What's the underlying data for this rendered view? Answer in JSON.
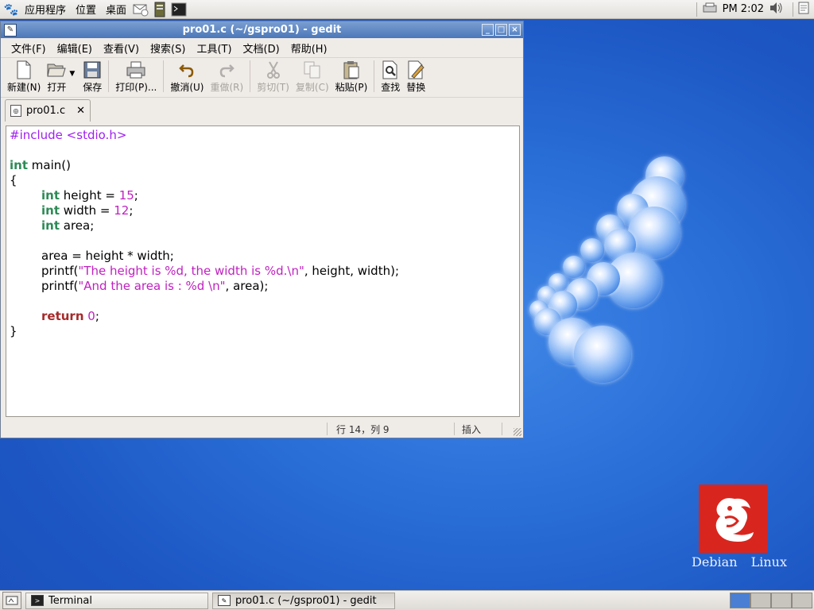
{
  "top_panel": {
    "menus": [
      "应用程序",
      "位置",
      "桌面"
    ],
    "clock": "PM 2:02"
  },
  "window": {
    "title": "pro01.c (~/gspro01) - gedit",
    "menus": [
      "文件(F)",
      "编辑(E)",
      "查看(V)",
      "搜索(S)",
      "工具(T)",
      "文档(D)",
      "帮助(H)"
    ],
    "toolbar": {
      "new": "新建(N)",
      "open": "打开",
      "save": "保存",
      "print": "打印(P)...",
      "undo": "撤消(U)",
      "redo": "重做(R)",
      "cut": "剪切(T)",
      "copy": "复制(C)",
      "paste": "粘贴(P)",
      "find": "查找",
      "replace": "替换"
    },
    "tab": {
      "label": "pro01.c"
    },
    "code": {
      "l1_pp": "#include <stdio.h>",
      "l3_type": "int",
      "l3_rest": " main()",
      "l4": "{",
      "l5_type": "int",
      "l5_a": " height = ",
      "l5_num": "15",
      "l5_b": ";",
      "l6_type": "int",
      "l6_a": " width = ",
      "l6_num": "12",
      "l6_b": ";",
      "l7_type": "int",
      "l7_a": " area;",
      "l9": "area = height * width;",
      "l10_a": "printf(",
      "l10_str": "\"The height is %d, the width is %d.\\n\"",
      "l10_b": ", height, width);",
      "l11_a": "printf(",
      "l11_str": "\"And the area is : %d \\n\"",
      "l11_b": ", area);",
      "l13_kw": "return",
      "l13_sp": " ",
      "l13_num": "0",
      "l13_b": ";",
      "l14": "}"
    },
    "status": {
      "position": "行 14，列 9",
      "mode": "插入"
    }
  },
  "desktop": {
    "logo_text": "Debian  Linux"
  },
  "taskbar": {
    "tasks": [
      "Terminal",
      "pro01.c (~/gspro01) - gedit"
    ]
  },
  "colors": {
    "titlebar": "#4b77b9",
    "desktop": "#2a6fd8",
    "keyword_type": "#2e8b57",
    "keyword": "#a52a2a",
    "string": "#c021c0",
    "preprocessor": "#a020f0",
    "logo_red": "#d8261f"
  }
}
